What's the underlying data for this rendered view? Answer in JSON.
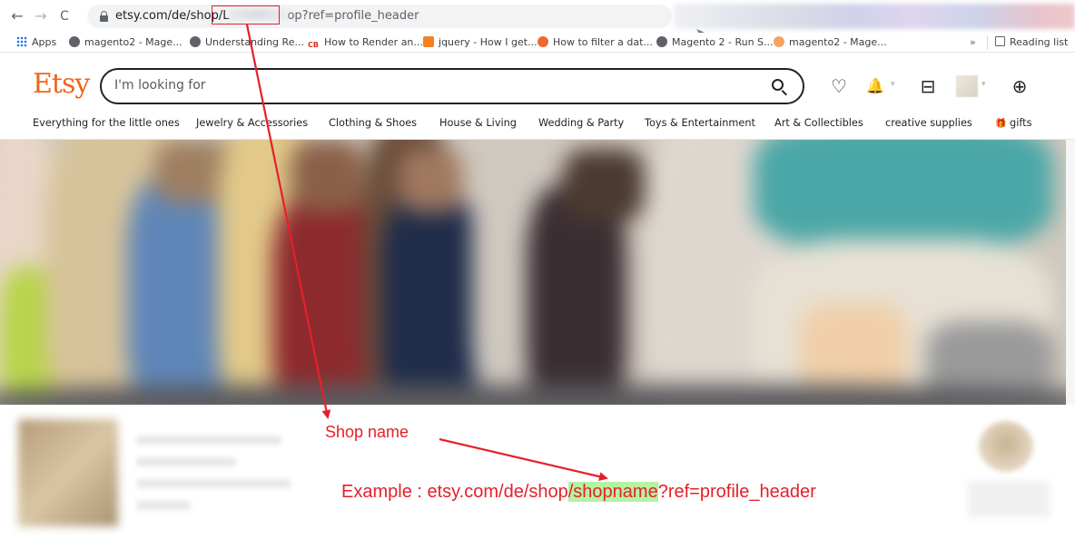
{
  "browser": {
    "nav": {
      "back": "←",
      "forward": "→",
      "reload": "C"
    },
    "url": {
      "host_path": "etsy.com/de/shop/",
      "redacted_prefix": "L",
      "suffix": "op?ref=profile_header"
    },
    "omni_icons": {
      "translate": "⊞",
      "share": "➤",
      "bookmark": "☆"
    },
    "bookmarks": [
      {
        "label": "Apps",
        "icon": "apps-grid-icon"
      },
      {
        "label": "magento2 - Mage...",
        "icon": "globe-icon"
      },
      {
        "label": "Understanding Re...",
        "icon": "globe-icon"
      },
      {
        "label": "How to Render an...",
        "icon": "cb-icon",
        "icon_text": "CB"
      },
      {
        "label": "jquery - How I get...",
        "icon": "stackoverflow-icon"
      },
      {
        "label": "How to filter a dat...",
        "icon": "magento-icon"
      },
      {
        "label": "Magento 2 - Run S...",
        "icon": "globe-icon"
      },
      {
        "label": "magento2 - Mage...",
        "icon": "magento-icon"
      }
    ],
    "more": "»",
    "reading_list": "Reading list"
  },
  "etsy": {
    "logo": "Etsy",
    "search": {
      "placeholder": "I'm looking for"
    },
    "icons": {
      "favorites": "♡",
      "notifications": "🔔",
      "shop_manager": "⊟",
      "cart": "⊕"
    },
    "caret": "▾",
    "categories": [
      "Everything for the little ones",
      "Jewelry & Accessories",
      "Clothing & Shoes",
      "House & Living",
      "Wedding & Party",
      "Toys & Entertainment",
      "Art & Collectibles",
      "creative supplies",
      "gifts"
    ],
    "gift_icon": "🎁"
  },
  "annotations": {
    "shop_name_label": "Shop name",
    "example_prefix": "Example : etsy.com/de/shop",
    "example_highlight": "/shopname",
    "example_suffix": "?ref=profile_header",
    "accent_color": "#e5202a",
    "highlight_color": "#b6f2a0"
  }
}
